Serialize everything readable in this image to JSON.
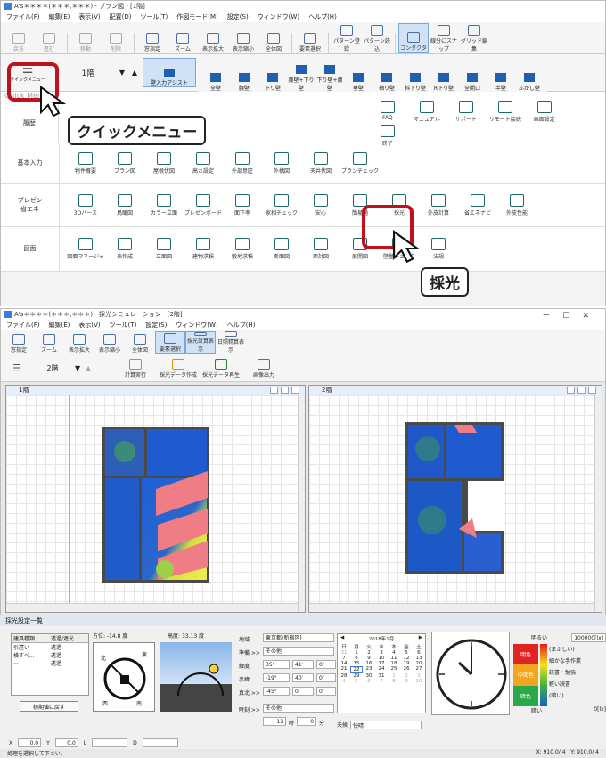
{
  "win1": {
    "title": "A's＊＊＊＊(＊＊＊,＊＊＊) - プラン図 - [1階]",
    "menu": [
      "ファイル(F)",
      "編集(E)",
      "表示(V)",
      "配置(D)",
      "ツール(T)",
      "作図モード(M)",
      "設定(S)",
      "ウィンドウ(W)",
      "ヘルプ(H)"
    ],
    "tools": [
      "戻る",
      "進む",
      "移動",
      "削除",
      "窓指定",
      "ズーム",
      "表示拡大",
      "表示縮小",
      "全体図",
      "要素選択",
      "パターン登録",
      "パターン読込",
      "コンダクタ",
      "線分にスナップ",
      "グリッド編集"
    ],
    "quick_label": "クイックメニュー",
    "floor": "1階",
    "active_wall": "壁入力アシスト",
    "walls": [
      "全壁",
      "腰壁",
      "下り壁",
      "腰壁+下り壁",
      "下り壁+腰壁",
      "垂壁",
      "袖り壁",
      "斜下り壁",
      "R下り壁",
      "全開口",
      "半壁",
      "ふかし壁"
    ],
    "quick_menu_title": "Quick Menu",
    "rows": [
      {
        "label": "履歴",
        "items": [
          "FAQ",
          "マニュアル",
          "サポート",
          "リモート接続",
          "画面設定",
          "終了"
        ]
      },
      {
        "label": "基本入力",
        "items": [
          "物件概要",
          "プラン図",
          "屋根伏図",
          "高さ設定",
          "外部意匠",
          "外構図",
          "天井伏図",
          "プランチェック"
        ]
      },
      {
        "label": "プレゼン\n省エネ",
        "items": [
          "3Dパース",
          "鳥瞰図",
          "カラー立面",
          "プレゼンボード",
          "面下率",
          "家相チェック",
          "安心",
          "簡易通",
          "採光",
          "外皮計算",
          "省エネナビ",
          "外皮性能"
        ]
      },
      {
        "label": "図面",
        "items": [
          "図面マネージャ",
          "表作成",
          "立面図",
          "建物求積",
          "敷地求積",
          "断面図",
          "矩計図",
          "展開図",
          "壁量チェック",
          "法規"
        ]
      }
    ],
    "callout1": "クイックメニュー",
    "callout2": "採光"
  },
  "win2": {
    "title": "A's＊＊＊＊(＊＊＊,＊＊＊) - 採光シミュレーション - [2階]",
    "menu": [
      "ファイル(F)",
      "編集(E)",
      "表示(V)",
      "ツール(T)",
      "設定(S)",
      "ウィンドウ(W)",
      "ヘルプ(H)"
    ],
    "tools": [
      "窓指定",
      "ズーム",
      "表示拡大",
      "表示縮小",
      "全体図",
      "要素選択",
      "採光計算表示",
      "日照精算表示"
    ],
    "floor": "2階",
    "actions": [
      "計算実行",
      "採光データ作成",
      "採光データ再生",
      "画像出力"
    ],
    "panel1": "1階",
    "panel2": "2階"
  },
  "settings": {
    "title": "採光設定一覧",
    "hoi": "方位:",
    "hoi_v": "-14.8 度",
    "koudo": "高度:",
    "koudo_v": "33.13 度",
    "table_headers": [
      "建具種類",
      "透過/遮光"
    ],
    "table_rows": [
      [
        "引違い",
        "透過"
      ],
      [
        "横すべ…",
        "透過"
      ],
      [
        "…",
        "透過"
      ]
    ],
    "reset_btn": "初期値に戻す",
    "compass": [
      "北",
      "東",
      "西",
      "南"
    ],
    "region_label": "地域",
    "region": "東京都(新宿区)",
    "standard_label": "準備 >>",
    "standard": "その他",
    "lat_label": "緯度",
    "lat": [
      "35°",
      "41′",
      "0″"
    ],
    "lon_label": "赤緯",
    "lon": [
      "-19°",
      "40′",
      "0″"
    ],
    "true_north_label": "真北 >>",
    "true_north": [
      "-45°",
      "0′",
      "0″"
    ],
    "time_label": "時刻 >>",
    "time_other": "その他",
    "hour": "11",
    "hour_unit": "時",
    "min": "0",
    "min_unit": "分",
    "weather_label": "天候",
    "weather": "快晴",
    "cal_title": "2018年1月",
    "cal_days": [
      "日",
      "月",
      "火",
      "水",
      "木",
      "金",
      "土"
    ],
    "cal": [
      [
        "31",
        "1",
        "2",
        "3",
        "4",
        "5",
        "6"
      ],
      [
        "7",
        "8",
        "9",
        "10",
        "11",
        "12",
        "13"
      ],
      [
        "14",
        "15",
        "16",
        "17",
        "18",
        "19",
        "20"
      ],
      [
        "21",
        "22",
        "23",
        "24",
        "25",
        "26",
        "27"
      ],
      [
        "28",
        "29",
        "30",
        "31",
        "1",
        "2",
        "3"
      ],
      [
        "4",
        "5",
        "6",
        "7",
        "8",
        "9",
        "10"
      ]
    ],
    "legend": {
      "header": "明るい",
      "max": "100000[lx]",
      "items": [
        "(まぶしい)",
        "細かな手作業",
        "読書・勉強",
        "軽い読書",
        "(暗い)"
      ],
      "min": "0[lx]",
      "bars": [
        "明色",
        "中間色",
        "暗色"
      ],
      "bottom": "暗い"
    }
  },
  "status": {
    "x_label": "X",
    "x": "0.0",
    "y_label": "Y",
    "y": "0.0",
    "l": "L",
    "d": "D",
    "msg": "処理を選択して下さい。",
    "coord_x": "X: 910.0/ 4",
    "coord_y": "Y: 910.0/ 4"
  }
}
